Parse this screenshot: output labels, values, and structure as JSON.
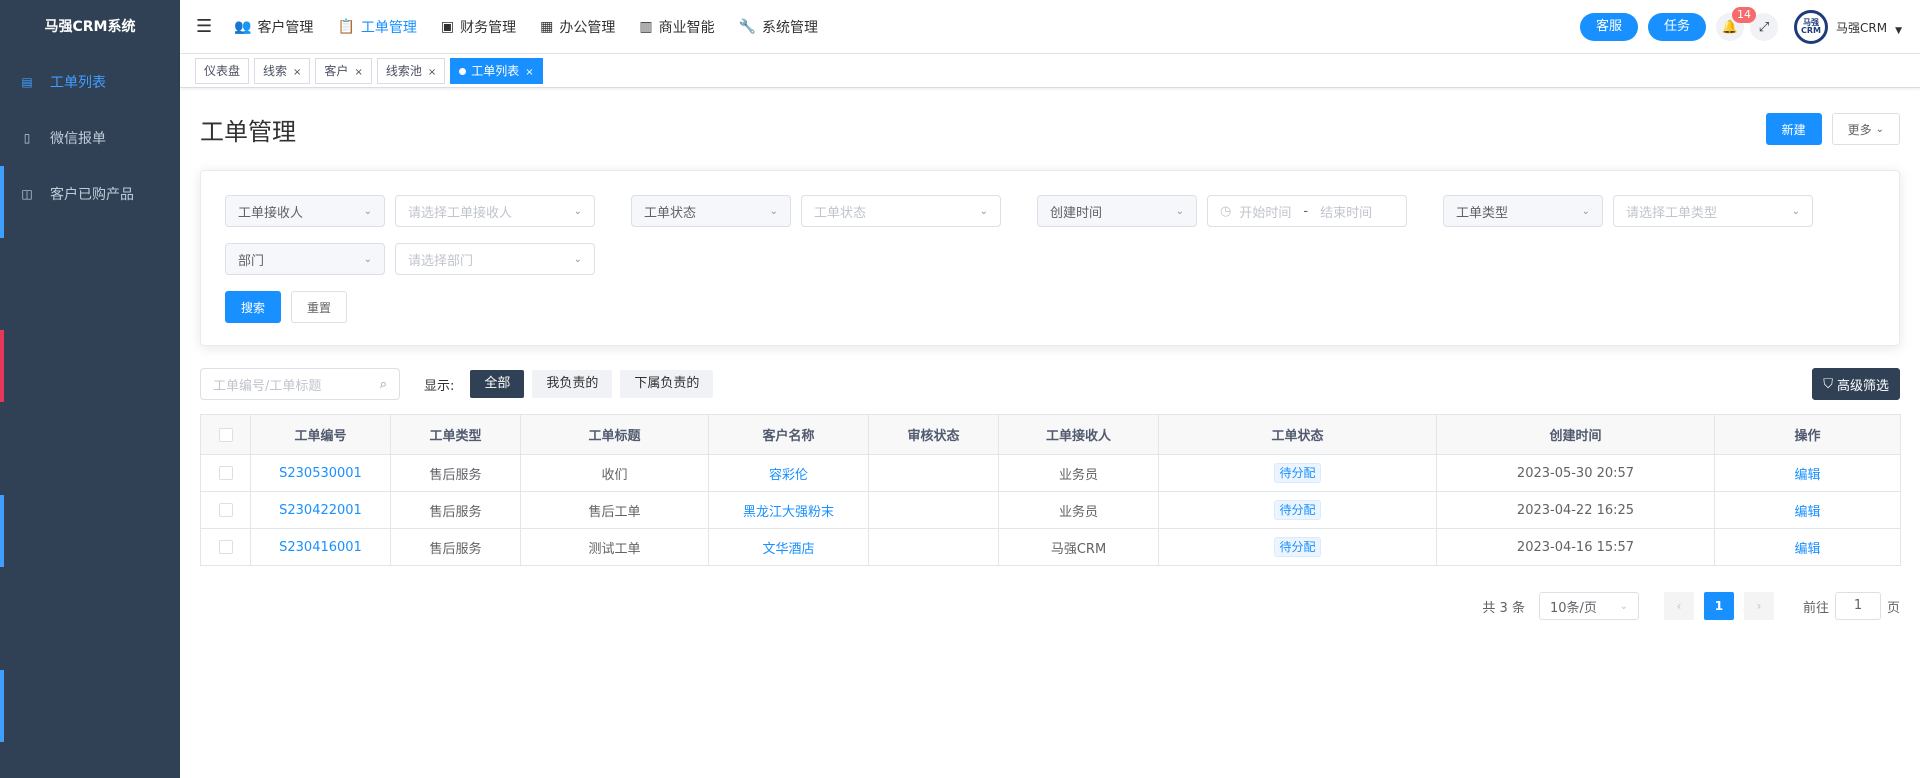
{
  "app": {
    "brand": "马强CRM系统"
  },
  "sidebar": {
    "items": [
      {
        "label": "工单列表",
        "icon": "document-icon",
        "active": true
      },
      {
        "label": "微信报单",
        "icon": "phone-icon",
        "active": false
      },
      {
        "label": "客户已购产品",
        "icon": "box-icon",
        "active": false
      }
    ]
  },
  "topnav": {
    "items": [
      {
        "label": "客户管理",
        "icon": "users-icon"
      },
      {
        "label": "工单管理",
        "icon": "clipboard-icon",
        "active": true
      },
      {
        "label": "财务管理",
        "icon": "wallet-icon"
      },
      {
        "label": "办公管理",
        "icon": "office-icon"
      },
      {
        "label": "商业智能",
        "icon": "chart-icon"
      },
      {
        "label": "系统管理",
        "icon": "wrench-icon"
      }
    ]
  },
  "header": {
    "service_label": "客服",
    "task_label": "任务",
    "notification_count": "14",
    "user_name": "马强CRM",
    "avatar_text": "马强CRM"
  },
  "tags": [
    {
      "label": "仪表盘",
      "closable": false
    },
    {
      "label": "线索",
      "closable": true
    },
    {
      "label": "客户",
      "closable": true
    },
    {
      "label": "线索池",
      "closable": true
    },
    {
      "label": "工单列表",
      "closable": true,
      "active": true
    }
  ],
  "page": {
    "title": "工单管理",
    "new_label": "新建",
    "more_label": "更多"
  },
  "filters": {
    "receiver": {
      "label": "工单接收人",
      "placeholder": "请选择工单接收人"
    },
    "status": {
      "label": "工单状态",
      "placeholder": "工单状态"
    },
    "created": {
      "label": "创建时间",
      "start": "开始时间",
      "sep": "-",
      "end": "结束时间"
    },
    "type": {
      "label": "工单类型",
      "placeholder": "请选择工单类型"
    },
    "dept": {
      "label": "部门",
      "placeholder": "请选择部门"
    },
    "search_label": "搜索",
    "reset_label": "重置"
  },
  "toolbar": {
    "search_placeholder": "工单编号/工单标题",
    "show_label": "显示:",
    "segments": [
      "全部",
      "我负责的",
      "下属负责的"
    ],
    "advanced_label": "高级筛选"
  },
  "table": {
    "headers": [
      "工单编号",
      "工单类型",
      "工单标题",
      "客户名称",
      "审核状态",
      "工单接收人",
      "工单状态",
      "创建时间",
      "操作"
    ],
    "rows": [
      {
        "id": "S230530001",
        "type": "售后服务",
        "title": "收们",
        "customer": "容彩伦",
        "audit": "",
        "receiver": "业务员",
        "status": "待分配",
        "created": "2023-05-30 20:57",
        "action": "编辑"
      },
      {
        "id": "S230422001",
        "type": "售后服务",
        "title": "售后工单",
        "customer": "黑龙江大强粉末",
        "audit": "",
        "receiver": "业务员",
        "status": "待分配",
        "created": "2023-04-22 16:25",
        "action": "编辑"
      },
      {
        "id": "S230416001",
        "type": "售后服务",
        "title": "测试工单",
        "customer": "文华酒店",
        "audit": "",
        "receiver": "马强CRM",
        "status": "待分配",
        "created": "2023-04-16 15:57",
        "action": "编辑"
      }
    ]
  },
  "pagination": {
    "total": "共 3 条",
    "page_size": "10条/页",
    "current": "1",
    "goto_label": "前往",
    "goto_value": "1",
    "page_unit": "页"
  },
  "colors": {
    "sidebar_bg": "#304156",
    "primary": "#1890ff",
    "accent_red": "#e6375a"
  }
}
